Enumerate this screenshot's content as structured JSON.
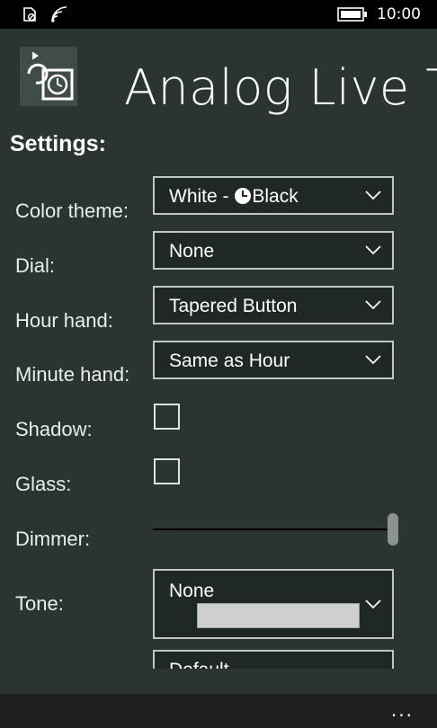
{
  "status_bar": {
    "time": "10:00",
    "icons": [
      "no-sim-icon",
      "wifi-icon",
      "battery-icon"
    ]
  },
  "header": {
    "title": "Analog Live Ti",
    "logo_icon": "clock-refresh-icon"
  },
  "settings": {
    "title": "Settings:",
    "color_theme": {
      "label": "Color theme:",
      "value_prefix": "White - ",
      "value_suffix": "Black",
      "value_icon": "clock-icon"
    },
    "dial": {
      "label": "Dial:",
      "value": "None"
    },
    "hour_hand": {
      "label": "Hour hand:",
      "value": "Tapered Button"
    },
    "minute_hand": {
      "label": "Minute hand:",
      "value": "Same as Hour"
    },
    "shadow": {
      "label": "Shadow:",
      "checked": false
    },
    "glass": {
      "label": "Glass:",
      "checked": false
    },
    "dimmer": {
      "label": "Dimmer:",
      "value_fraction": 1.0
    },
    "tone": {
      "label": "Tone:",
      "value": "None",
      "swatch_color": "#cfcfcf"
    },
    "partial_combo": {
      "value": "Default"
    }
  },
  "app_bar": {
    "more_label": "..."
  },
  "colors": {
    "background": "#2a3533",
    "combo_border": "#bfc6c4",
    "status_bar": "#000000",
    "app_bar": "#1f1f1f"
  }
}
